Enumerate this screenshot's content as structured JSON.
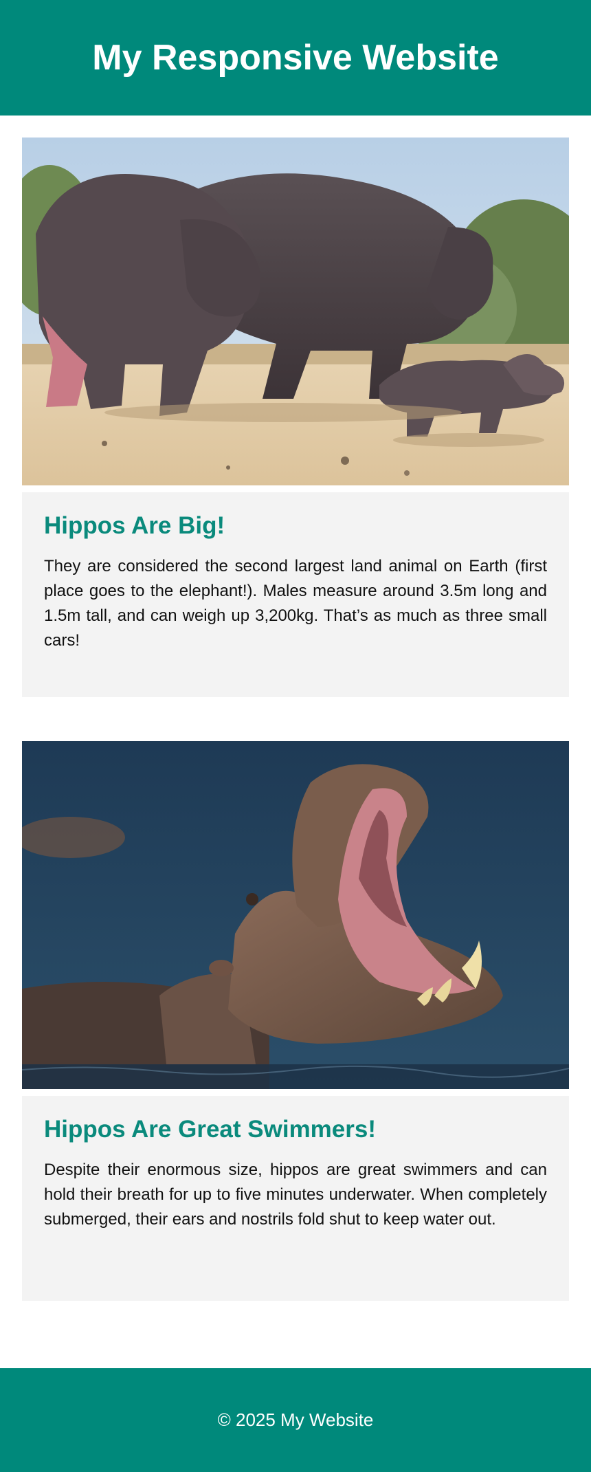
{
  "header": {
    "title": "My Responsive Website"
  },
  "cards": [
    {
      "heading": "Hippos Are Big!",
      "text": "They are considered the second largest land animal on Earth (first place goes to the elephant!). Males measure around 3.5m long and 1.5m tall, and can weigh up 3,200kg. That’s as much as three small cars!",
      "image_alt": "hippo family on sand"
    },
    {
      "heading": "Hippos Are Great Swimmers!",
      "text": "Despite their enormous size, hippos are great swimmers and can hold their breath for up to five minutes underwater. When completely submerged, their ears and nostrils fold shut to keep water out.",
      "image_alt": "hippo yawning in water"
    }
  ],
  "footer": {
    "text": "© 2025 My Website"
  },
  "colors": {
    "brand": "#00897b",
    "heading": "#0a8a7c",
    "card_bg": "#f3f3f3"
  }
}
